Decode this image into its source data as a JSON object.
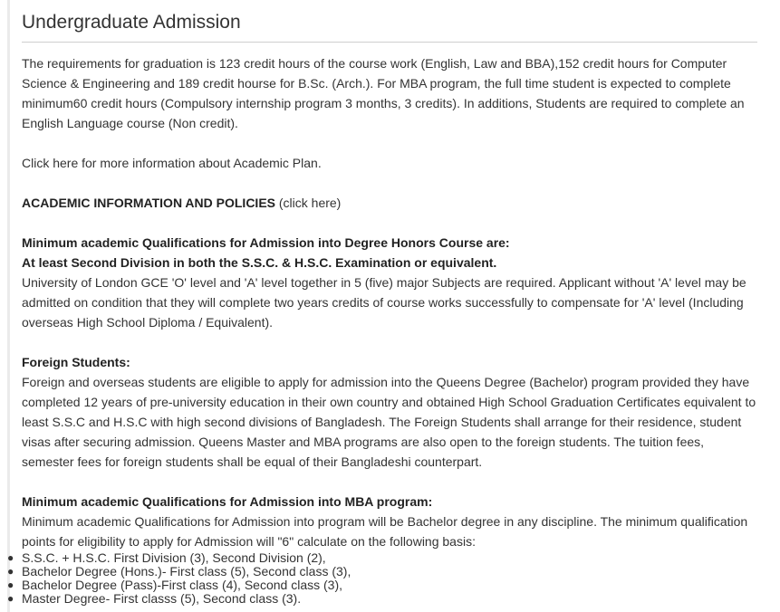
{
  "heading": "Undergraduate Admission",
  "intro": "The requirements for graduation is 123 credit hours of the course work (English, Law and BBA),152 credit hours for Computer Science & Engineering and 189 credit hourse for B.Sc. (Arch.). For MBA program, the full time student is expected to complete minimum60 credit hours (Compulsory internship program 3 months, 3 credits). In additions, Students are required to complete an English Language course (Non credit).",
  "academic_plan_link": "Click here for more information about Academic Plan.",
  "policies": {
    "title": "ACADEMIC INFORMATION AND POLICIES",
    "link": "(click here)"
  },
  "degree_honors": {
    "title_line1": "Minimum academic Qualifications for Admission into Degree Honors Course are:",
    "title_line2": "At least Second Division in both the S.S.C. & H.S.C. Examination or equivalent.",
    "body": "University of London GCE 'O' level and 'A' level together in 5 (five) major Subjects are required. Applicant without 'A' level may be admitted on condition that they will complete two years credits of course works successfully to compensate for 'A' level (Including overseas High School Diploma / Equivalent)."
  },
  "foreign_students": {
    "title": "Foreign Students:",
    "body": "Foreign and overseas students are eligible to apply for admission into the Queens Degree (Bachelor) program provided they have completed 12 years of pre-university education in their own country and obtained High School Graduation Certificates equivalent to least S.S.C and H.S.C with high second divisions of Bangladesh. The Foreign Students shall arrange for their residence, student visas after securing admission. Queens Master and MBA programs are also open to the foreign students. The tuition fees, semester fees for foreign students shall be equal of their Bangladeshi counterpart."
  },
  "mba": {
    "title": "Minimum academic Qualifications for Admission into MBA program:",
    "body": "Minimum academic Qualifications for Admission into program will be Bachelor degree in any discipline. The minimum qualification points for eligibility to apply for Admission will \"6\" calculate on the following basis:",
    "basis": [
      "S.S.C. + H.S.C. First Division (3), Second Division (2),",
      "Bachelor Degree (Hons.)- First class (5), Second class (3),",
      "Bachelor Degree (Pass)-First class (4), Second class (3),",
      "Master Degree- First classs (5), Second class (3)."
    ]
  }
}
